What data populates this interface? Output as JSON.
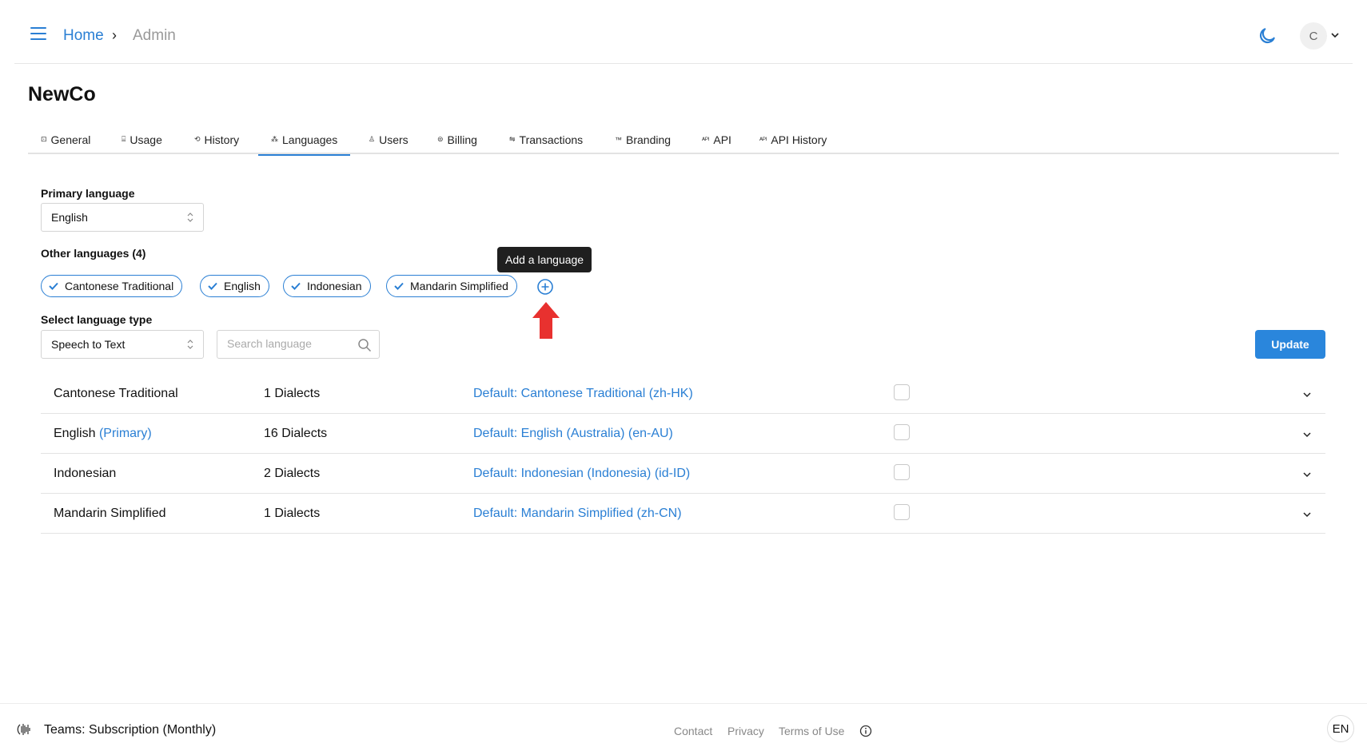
{
  "header": {
    "breadcrumb": {
      "home": "Home",
      "separator": "›",
      "current": "Admin"
    },
    "avatar_initial": "C",
    "icons": {
      "menu": "hamburger-icon",
      "theme": "moon-icon",
      "caret": "chevron-down-icon"
    }
  },
  "page": {
    "title": "NewCo"
  },
  "tabs": [
    {
      "label": "General",
      "icon": "⊡"
    },
    {
      "label": "Usage",
      "icon": "⌸"
    },
    {
      "label": "History",
      "icon": "⟲"
    },
    {
      "label": "Languages",
      "icon": "⁂"
    },
    {
      "label": "Users",
      "icon": "♙"
    },
    {
      "label": "Billing",
      "icon": "⊜"
    },
    {
      "label": "Transactions",
      "icon": "⇋"
    },
    {
      "label": "Branding",
      "icon": "™"
    },
    {
      "label": "API",
      "icon": "ᴬᴾᴵ"
    },
    {
      "label": "API History",
      "icon": "ᴬᴾᴵ"
    }
  ],
  "active_tab": "Languages",
  "primary_language": {
    "label": "Primary language",
    "value": "English"
  },
  "other_languages": {
    "label": "Other languages (4)",
    "chips": [
      "Cantonese Traditional",
      "English",
      "Indonesian",
      "Mandarin Simplified"
    ],
    "add_tooltip": "Add a language"
  },
  "language_type": {
    "label": "Select language type",
    "value": "Speech to Text"
  },
  "search": {
    "placeholder": "Search language",
    "value": ""
  },
  "update_label": "Update",
  "languages": [
    {
      "name": "Cantonese Traditional",
      "primary_tag": "",
      "dialects": "1 Dialects",
      "default": "Default: Cantonese Traditional (zh-HK)",
      "checked": false
    },
    {
      "name": "English",
      "primary_tag": "(Primary)",
      "dialects": "16 Dialects",
      "default": "Default: English (Australia) (en-AU)",
      "checked": false
    },
    {
      "name": "Indonesian",
      "primary_tag": "",
      "dialects": "2 Dialects",
      "default": "Default: Indonesian (Indonesia) (id-ID)",
      "checked": false
    },
    {
      "name": "Mandarin Simplified",
      "primary_tag": "",
      "dialects": "1 Dialects",
      "default": "Default: Mandarin Simplified (zh-CN)",
      "checked": false
    }
  ],
  "footer": {
    "plan": "Teams: Subscription (Monthly)",
    "links": [
      "Contact",
      "Privacy",
      "Terms of Use"
    ],
    "locale": "EN"
  },
  "colors": {
    "accent": "#2a7fd4",
    "button": "#2a86dc",
    "tooltip_bg": "#1f1f1f",
    "annotation_arrow": "#e8312f"
  }
}
